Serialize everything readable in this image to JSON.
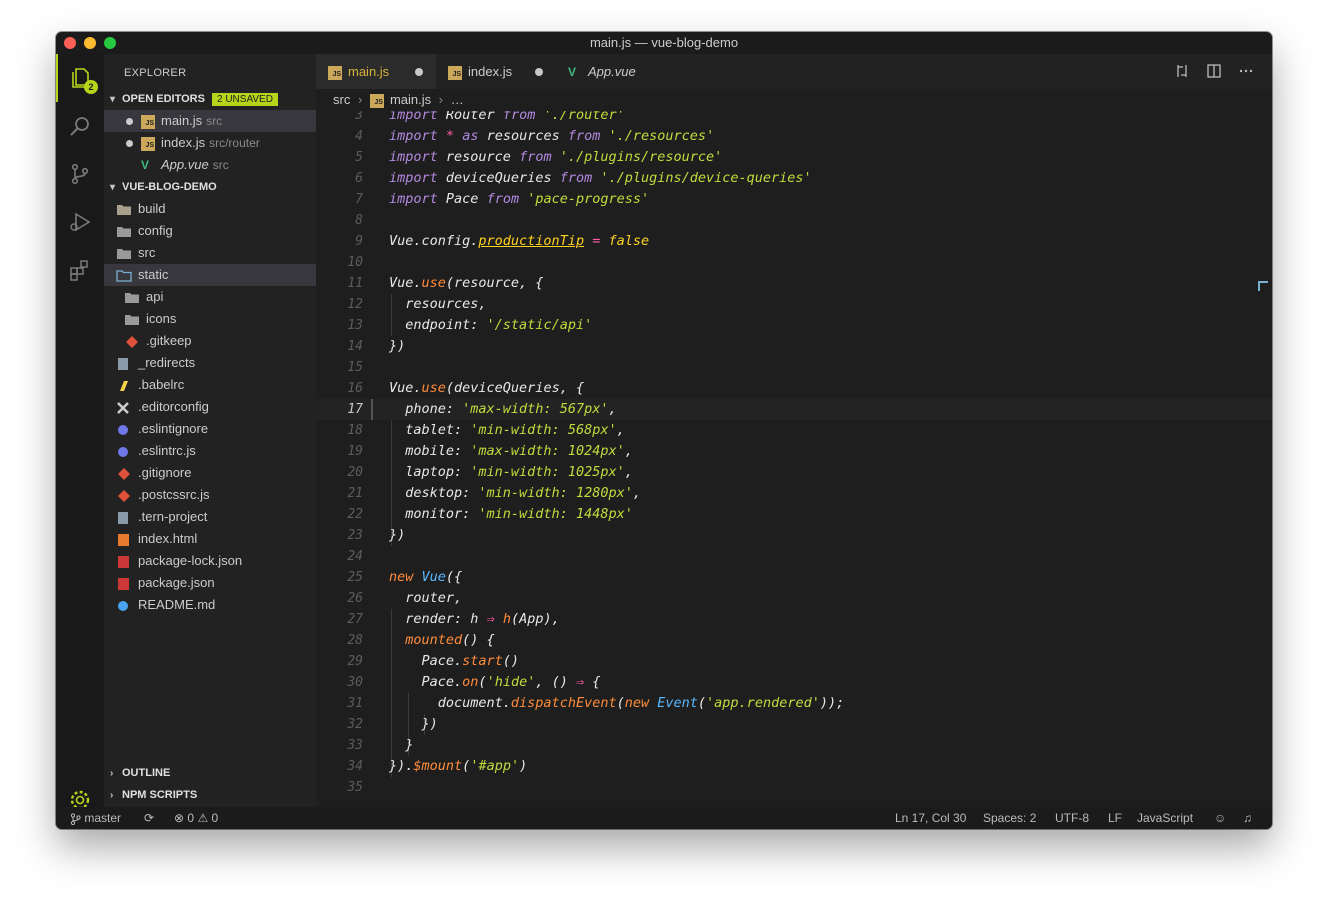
{
  "window": {
    "title": "main.js — vue-blog-demo"
  },
  "activity_bar": {
    "explorer_badge": "2"
  },
  "sidebar": {
    "title": "EXPLORER",
    "open_editors": {
      "label": "OPEN EDITORS",
      "unsaved": "2 UNSAVED",
      "items": [
        {
          "name": "main.js",
          "path": "src"
        },
        {
          "name": "index.js",
          "path": "src/router"
        },
        {
          "name": "App.vue",
          "path": "src"
        }
      ]
    },
    "project": {
      "label": "VUE-BLOG-DEMO",
      "items": [
        {
          "name": "build",
          "icon": "folder-build-icon"
        },
        {
          "name": "config",
          "icon": "folder-icon"
        },
        {
          "name": "src",
          "icon": "folder-src-icon"
        },
        {
          "name": "static",
          "icon": "folder-open-icon"
        },
        {
          "name": "api",
          "icon": "folder-icon"
        },
        {
          "name": "icons",
          "icon": "folder-icon"
        },
        {
          "name": ".gitkeep",
          "icon": "git-icon"
        },
        {
          "name": "_redirects",
          "icon": "file-icon"
        },
        {
          "name": ".babelrc",
          "icon": "babel-icon"
        },
        {
          "name": ".editorconfig",
          "icon": "tools-icon"
        },
        {
          "name": ".eslintignore",
          "icon": "eslint-icon"
        },
        {
          "name": ".eslintrc.js",
          "icon": "eslint-icon"
        },
        {
          "name": ".gitignore",
          "icon": "git-icon"
        },
        {
          "name": ".postcssrc.js",
          "icon": "postcss-icon"
        },
        {
          "name": ".tern-project",
          "icon": "file-icon"
        },
        {
          "name": "index.html",
          "icon": "html-icon"
        },
        {
          "name": "package-lock.json",
          "icon": "npm-icon"
        },
        {
          "name": "package.json",
          "icon": "npm-icon"
        },
        {
          "name": "README.md",
          "icon": "info-icon"
        }
      ]
    },
    "outline": "OUTLINE",
    "npm_scripts": "NPM SCRIPTS"
  },
  "tabs": [
    {
      "label": "main.js",
      "active": true,
      "dirty": true
    },
    {
      "label": "index.js",
      "active": false,
      "dirty": true
    },
    {
      "label": "App.vue",
      "active": false,
      "dirty": false
    }
  ],
  "breadcrumb": {
    "folder": "src",
    "file": "main.js",
    "more": "…"
  },
  "editor": {
    "current_line": 17,
    "line_numbers": [
      "3",
      "4",
      "5",
      "6",
      "7",
      "8",
      "9",
      "10",
      "11",
      "12",
      "13",
      "14",
      "15",
      "16",
      "17",
      "18",
      "19",
      "20",
      "21",
      "22",
      "23",
      "24",
      "25",
      "26",
      "27",
      "28",
      "29",
      "30",
      "31",
      "32",
      "33",
      "34",
      "35"
    ],
    "lines": [
      "import Router from './router'",
      "import * as resources from './resources'",
      "import resource from './plugins/resource'",
      "import deviceQueries from './plugins/device-queries'",
      "import Pace from 'pace-progress'",
      "",
      "Vue.config.productionTip = false",
      "",
      "Vue.use(resource, {",
      "  resources,",
      "  endpoint: '/static/api'",
      "})",
      "",
      "Vue.use(deviceQueries, {",
      "  phone: 'max-width: 567px',",
      "  tablet: 'min-width: 568px',",
      "  mobile: 'max-width: 1024px',",
      "  laptop: 'min-width: 1025px',",
      "  desktop: 'min-width: 1280px',",
      "  monitor: 'min-width: 1448px'",
      "})",
      "",
      "new Vue({",
      "  router,",
      "  render: h ⇒ h(App),",
      "  mounted() {",
      "    Pace.start()",
      "    Pace.on('hide', () ⇒ {",
      "      document.dispatchEvent(new Event('app.rendered'));",
      "    })",
      "  }",
      "}).$mount('#app')",
      ""
    ]
  },
  "status_bar": {
    "branch": "master",
    "errors": "0",
    "warnings": "0",
    "position": "Ln 17, Col 30",
    "spaces": "Spaces: 2",
    "encoding": "UTF-8",
    "eol": "LF",
    "language": "JavaScript"
  },
  "colors": {
    "accent": "#b8d41a",
    "keyword": "#b389e0",
    "string": "#c2dc3c",
    "function": "#ff8c3b",
    "class": "#58b8ff",
    "operator": "#ff5da2",
    "constant": "#ffd21e"
  }
}
